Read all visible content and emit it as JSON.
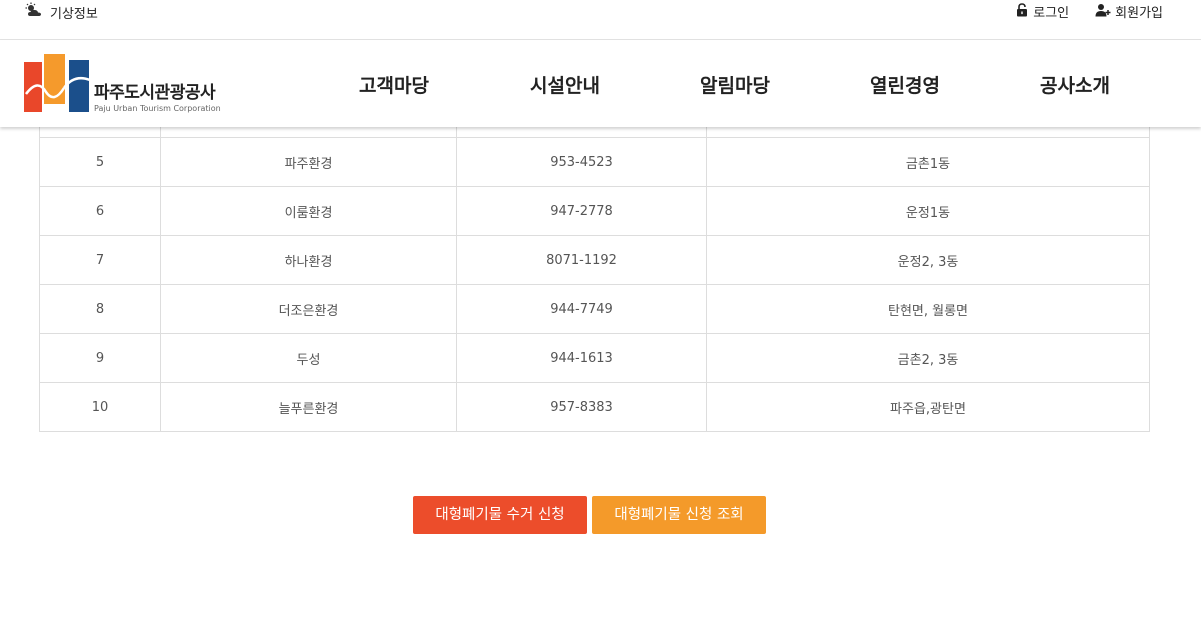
{
  "topbar": {
    "weather_label": "기상정보",
    "weather_icon": "weather-cloud-sun-icon",
    "login_label": "로그인",
    "login_icon": "lock-icon",
    "signup_label": "회원가입",
    "signup_icon": "user-plus-icon"
  },
  "logo": {
    "name_ko": "파주도시관광공사",
    "name_en": "Paju Urban Tourism Corporation",
    "colors": {
      "orange_red": "#e9472a",
      "orange": "#f59a2c",
      "navy": "#1b4f8b"
    }
  },
  "nav": {
    "items": [
      "고객마당",
      "시설안내",
      "알림마당",
      "열린경영",
      "공사소개"
    ]
  },
  "table": {
    "rows": [
      [
        "5",
        "파주환경",
        "953-4523",
        "금촌1동"
      ],
      [
        "6",
        "이룸환경",
        "947-2778",
        "운정1동"
      ],
      [
        "7",
        "하나환경",
        "8071-1192",
        "운정2, 3동"
      ],
      [
        "8",
        "더조은환경",
        "944-7749",
        "탄현면, 월롱면"
      ],
      [
        "9",
        "두성",
        "944-1613",
        "금촌2, 3동"
      ],
      [
        "10",
        "늘푸른환경",
        "957-8383",
        "파주읍,광탄면"
      ]
    ]
  },
  "buttons": {
    "apply_label": "대형폐기물 수거 신청",
    "lookup_label": "대형폐기물 신청 조회",
    "apply_color": "#ec4d2b",
    "lookup_color": "#f49a2a"
  }
}
